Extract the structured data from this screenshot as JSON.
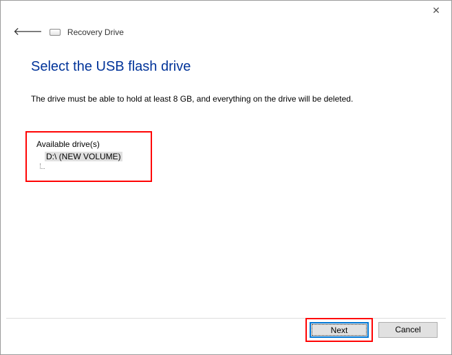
{
  "window": {
    "title": "Recovery Drive"
  },
  "page": {
    "heading": "Select the USB flash drive",
    "description": "The drive must be able to hold at least 8 GB, and everything on the drive will be deleted."
  },
  "drives": {
    "label": "Available drive(s)",
    "items": [
      {
        "text": "D:\\ (NEW VOLUME)"
      }
    ]
  },
  "buttons": {
    "next": "Next",
    "cancel": "Cancel"
  }
}
